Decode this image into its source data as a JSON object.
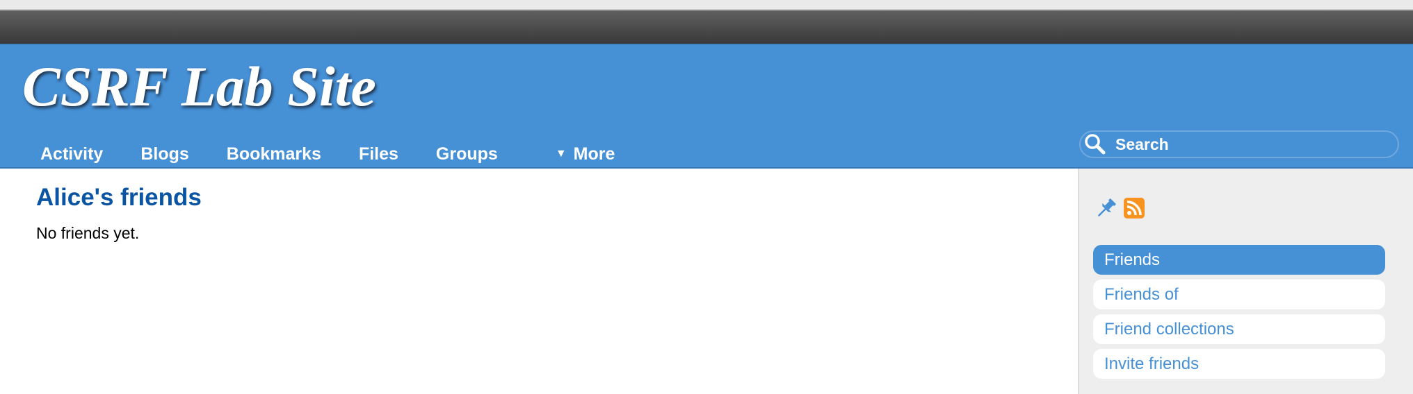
{
  "site": {
    "title": "CSRF Lab Site"
  },
  "nav": {
    "items": [
      {
        "label": "Activity"
      },
      {
        "label": "Blogs"
      },
      {
        "label": "Bookmarks"
      },
      {
        "label": "Files"
      },
      {
        "label": "Groups"
      },
      {
        "label": "More",
        "caret": "▼"
      }
    ]
  },
  "search": {
    "placeholder": "Search",
    "icon": "search-icon"
  },
  "main": {
    "title": "Alice's friends",
    "empty_message": "No friends yet."
  },
  "sidebar": {
    "icons": [
      "pin-icon",
      "rss-icon"
    ],
    "menu": [
      {
        "label": "Friends",
        "selected": true
      },
      {
        "label": "Friends of",
        "selected": false
      },
      {
        "label": "Friend collections",
        "selected": false
      },
      {
        "label": "Invite friends",
        "selected": false
      }
    ]
  },
  "colors": {
    "header": "#4690d6",
    "title_link": "#0a54a4",
    "topbar": "#4a4a4a",
    "sidebar_bg": "#eeeeee",
    "rss": "#f7931e"
  }
}
